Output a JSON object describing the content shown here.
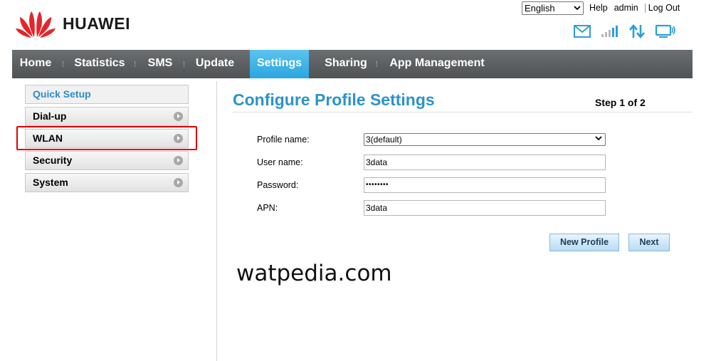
{
  "header": {
    "brand": "HUAWEI",
    "language": "English",
    "help": "Help",
    "user": "admin",
    "logout": "Log Out",
    "status_icons": [
      "envelope-icon",
      "signal-icon",
      "data-transfer-icon",
      "monitor-icon"
    ],
    "colors": {
      "logo_red": "#e4252a",
      "status_blue": "#2a9fd8"
    }
  },
  "nav": {
    "items": [
      "Home",
      "Statistics",
      "SMS",
      "Update",
      "Settings",
      "Sharing",
      "App Management"
    ],
    "active": "Settings",
    "colors": {
      "bar": "#5a5d5f",
      "active": "#3db3e8"
    }
  },
  "sidebar": {
    "items": [
      {
        "label": "Quick Setup",
        "arrow": false,
        "selected": true
      },
      {
        "label": "Dial-up",
        "arrow": true
      },
      {
        "label": "WLAN",
        "arrow": true,
        "highlighted": true
      },
      {
        "label": "Security",
        "arrow": true
      },
      {
        "label": "System",
        "arrow": true
      }
    ],
    "highlight_color": "#e00000"
  },
  "main": {
    "title": "Configure Profile Settings",
    "step": "Step 1 of 2",
    "form": {
      "profile_name_label": "Profile name:",
      "profile_name_value": "3(default)",
      "user_name_label": "User name:",
      "user_name_value": "3data",
      "password_label": "Password:",
      "password_value": "••••••••",
      "apn_label": "APN:",
      "apn_value": "3data"
    },
    "new_profile_button": "New Profile",
    "next_button": "Next"
  },
  "watermark": "watpedia.com"
}
